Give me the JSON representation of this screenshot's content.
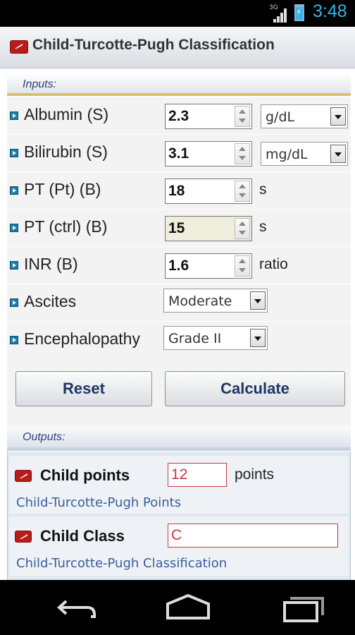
{
  "status_bar": {
    "network": "3G",
    "time": "3:48",
    "accent_color": "#33b5e5"
  },
  "title": "Child-Turcotte-Pugh Classification",
  "inputs_header": "Inputs:",
  "inputs": [
    {
      "label": "Albumin (S)",
      "value": "2.3",
      "unit_select": "g/dL"
    },
    {
      "label": "Bilirubin (S)",
      "value": "3.1",
      "unit_select": "mg/dL"
    },
    {
      "label": "PT (Pt) (B)",
      "value": "18",
      "unit": "s"
    },
    {
      "label": "PT (ctrl) (B)",
      "value": "15",
      "unit": "s"
    },
    {
      "label": "INR (B)",
      "value": "1.6",
      "unit": "ratio"
    },
    {
      "label": "Ascites",
      "select_value": "Moderate"
    },
    {
      "label": "Encephalopathy",
      "select_value": "Grade II"
    }
  ],
  "buttons": {
    "reset": "Reset",
    "calculate": "Calculate"
  },
  "outputs_header": "Outputs:",
  "outputs": [
    {
      "label": "Child points",
      "value": "12",
      "unit": "points",
      "description": "Child-Turcotte-Pugh Points"
    },
    {
      "label": "Child Class",
      "value": "C",
      "description": "Child-Turcotte-Pugh Classification"
    }
  ],
  "colors": {
    "title_icon": "#b91b1b",
    "output_value": "#c8383d",
    "section_header_text": "#2a3f7a"
  },
  "nav_icons": [
    "back-icon",
    "home-icon",
    "recent-apps-icon"
  ]
}
